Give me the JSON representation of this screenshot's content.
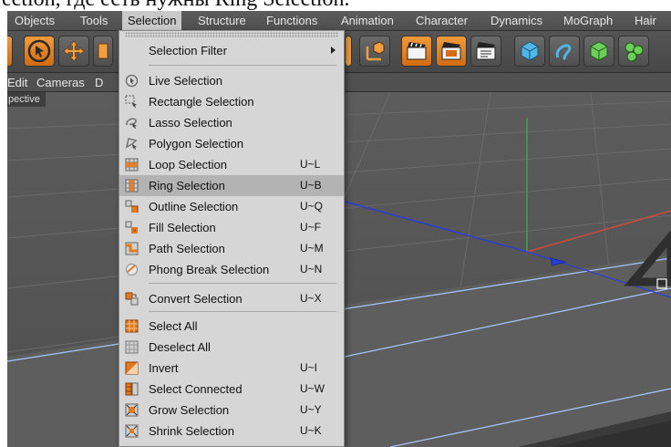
{
  "caption": {
    "text": "ection, где есть нужны Ring Selection."
  },
  "menubar": {
    "items": [
      "Objects",
      "Tools",
      "Selection",
      "Structure",
      "Functions",
      "Animation",
      "Character",
      "Dynamics",
      "MoGraph",
      "Hair"
    ],
    "active": "Selection"
  },
  "viewbar": {
    "edit": "Edit",
    "cameras": "Cameras",
    "d": "D"
  },
  "viewport": {
    "label": "pective"
  },
  "dropdown": {
    "filter": {
      "label": "Selection Filter"
    },
    "items": [
      {
        "label": "Live Selection",
        "shortcut": "",
        "icon": "live-selection-icon"
      },
      {
        "label": "Rectangle Selection",
        "shortcut": "",
        "icon": "rectangle-selection-icon"
      },
      {
        "label": "Lasso Selection",
        "shortcut": "",
        "icon": "lasso-selection-icon"
      },
      {
        "label": "Polygon Selection",
        "shortcut": "",
        "icon": "polygon-selection-icon"
      },
      {
        "label": "Loop Selection",
        "shortcut": "U~L",
        "icon": "loop-selection-icon"
      },
      {
        "label": "Ring Selection",
        "shortcut": "U~B",
        "icon": "ring-selection-icon"
      },
      {
        "label": "Outline Selection",
        "shortcut": "U~Q",
        "icon": "outline-selection-icon"
      },
      {
        "label": "Fill Selection",
        "shortcut": "U~F",
        "icon": "fill-selection-icon"
      },
      {
        "label": "Path Selection",
        "shortcut": "U~M",
        "icon": "path-selection-icon"
      },
      {
        "label": "Phong Break Selection",
        "shortcut": "U~N",
        "icon": "phong-break-selection-icon"
      },
      {
        "label": "Convert Selection",
        "shortcut": "U~X",
        "icon": "convert-selection-icon"
      },
      {
        "label": "Select All",
        "shortcut": "",
        "icon": "select-all-icon"
      },
      {
        "label": "Deselect All",
        "shortcut": "",
        "icon": "deselect-all-icon"
      },
      {
        "label": "Invert",
        "shortcut": "U~I",
        "icon": "invert-icon"
      },
      {
        "label": "Select Connected",
        "shortcut": "U~W",
        "icon": "select-connected-icon"
      },
      {
        "label": "Grow Selection",
        "shortcut": "U~Y",
        "icon": "grow-selection-icon"
      },
      {
        "label": "Shrink Selection",
        "shortcut": "U~K",
        "icon": "shrink-selection-icon"
      }
    ],
    "highlighted": "Ring Selection"
  },
  "colors": {
    "accent_orange": "#e07a20",
    "menu_bg": "#d6d6d6",
    "highlight": "#b3b3b3",
    "axis_red": "#d04a3a",
    "axis_green": "#3fa34a",
    "axis_blue": "#2b3fd6"
  }
}
